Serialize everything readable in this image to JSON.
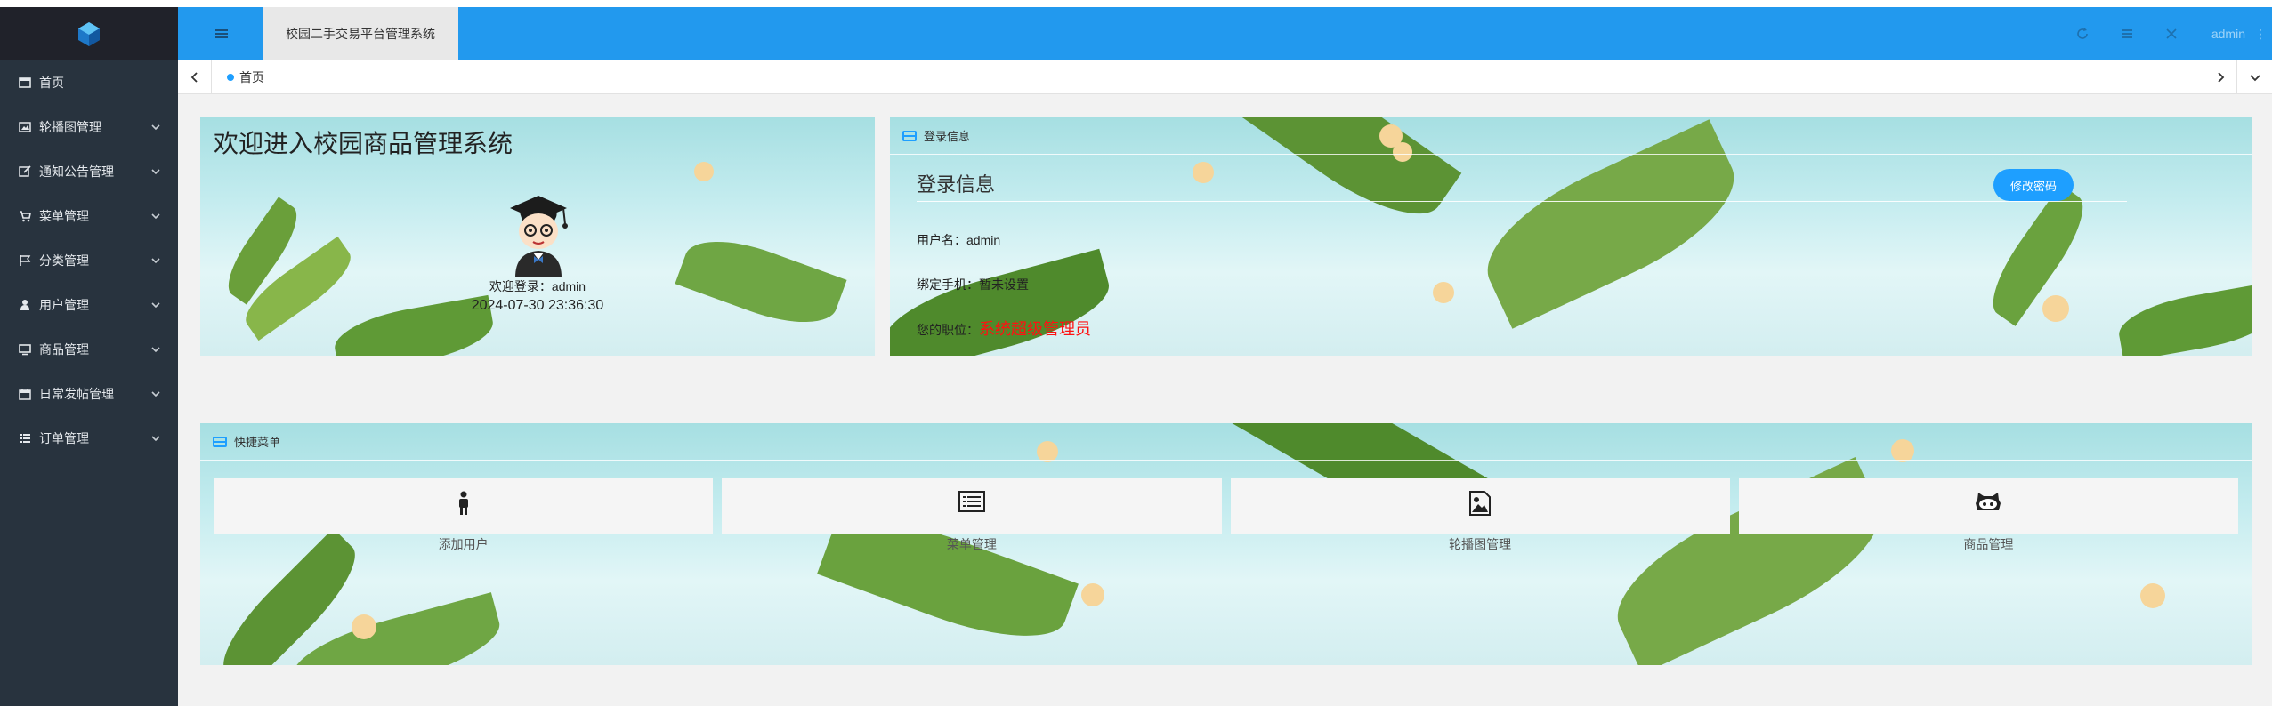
{
  "header": {
    "app_title": "校园二手交易平台管理系统",
    "user": "admin",
    "more": "⋮"
  },
  "sidebar": {
    "items": [
      {
        "label": "首页",
        "icon": "home-icon"
      },
      {
        "label": "轮播图管理",
        "icon": "image-icon"
      },
      {
        "label": "通知公告管理",
        "icon": "edit-icon"
      },
      {
        "label": "菜单管理",
        "icon": "cart-icon"
      },
      {
        "label": "分类管理",
        "icon": "flag-icon"
      },
      {
        "label": "用户管理",
        "icon": "user-icon"
      },
      {
        "label": "商品管理",
        "icon": "monitor-icon"
      },
      {
        "label": "日常发帖管理",
        "icon": "calendar-icon"
      },
      {
        "label": "订单管理",
        "icon": "list-icon"
      }
    ]
  },
  "tabbar": {
    "active_tab": "首页"
  },
  "welcome": {
    "title": "欢迎进入校园商品管理系统",
    "greeting": "欢迎登录：admin",
    "datetime": "2024-07-30 23:36:30"
  },
  "login_info": {
    "header": "登录信息",
    "title": "登录信息",
    "change_password": "修改密码",
    "username": "用户名：admin",
    "phone": "绑定手机：暂未设置",
    "role_label": "您的职位：",
    "role_value": "系统超级管理员"
  },
  "quick_menu": {
    "header": "快捷菜单",
    "items": [
      {
        "label": "添加用户",
        "icon": "person-icon"
      },
      {
        "label": "菜单管理",
        "icon": "list-icon"
      },
      {
        "label": "轮播图管理",
        "icon": "picture-icon"
      },
      {
        "label": "商品管理",
        "icon": "github-icon"
      }
    ]
  },
  "colors": {
    "accent": "#1e9fff",
    "header": "#2299ee",
    "sidebar": "#28333e",
    "role": "#ff1111"
  }
}
